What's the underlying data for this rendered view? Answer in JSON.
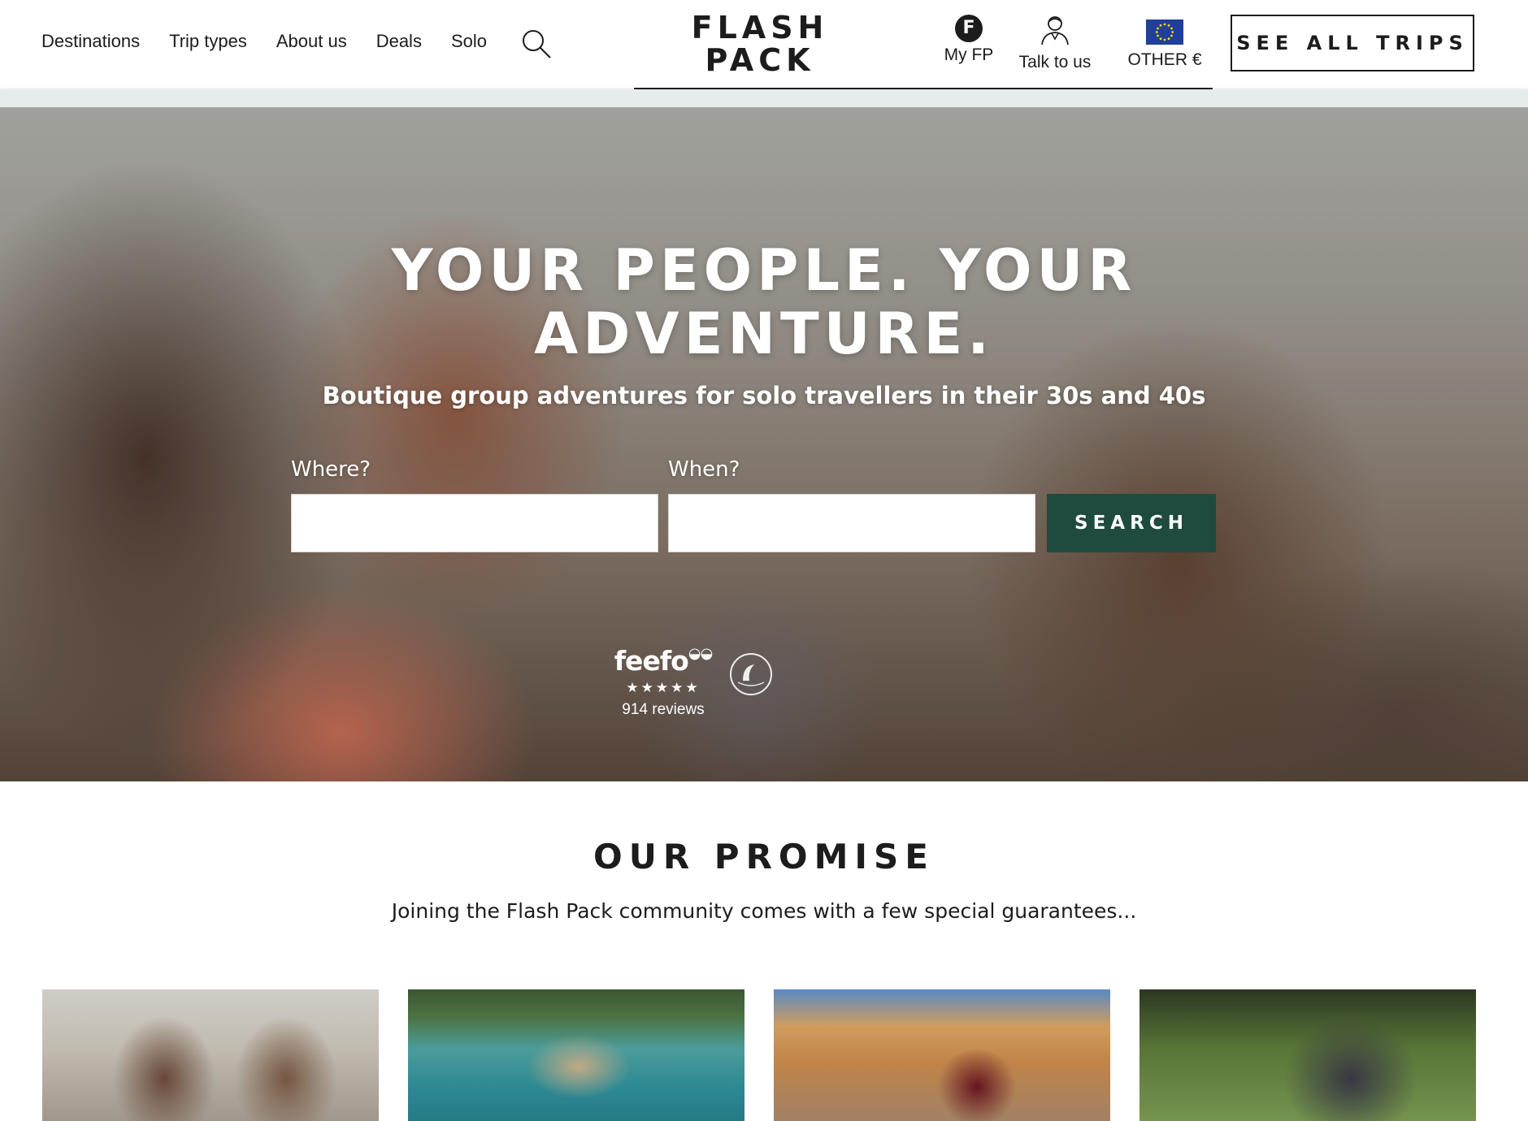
{
  "nav": {
    "items": [
      {
        "label": "Destinations"
      },
      {
        "label": "Trip types"
      },
      {
        "label": "About us"
      },
      {
        "label": "Deals"
      },
      {
        "label": "Solo"
      }
    ],
    "search_icon": "search-icon"
  },
  "logo": {
    "line1": "FLASH",
    "line2": "PACK"
  },
  "utility": {
    "my_fp": {
      "label": "My FP",
      "badge": "F"
    },
    "talk": {
      "label": "Talk to us",
      "icon": "person-headset-icon"
    },
    "currency": {
      "label": "OTHER  €",
      "icon": "eu-flag-icon"
    }
  },
  "cta": {
    "see_all_trips": "SEE ALL TRIPS"
  },
  "hero": {
    "title_line1": "YOUR PEOPLE. YOUR",
    "title_line2": "ADVENTURE.",
    "subtitle": "Boutique group adventures for solo travellers in their 30s and 40s",
    "where_label": "Where?",
    "where_value": "",
    "when_label": "When?",
    "when_value": "",
    "search_button": "SEARCH",
    "feefo_logo": "feefo",
    "feefo_stars": "★★★★★",
    "feefo_reviews": "914 reviews",
    "feefo_rating": 5
  },
  "promise": {
    "title": "OUR PROMISE",
    "subtitle": "Joining the Flash Pack community comes with a few special guarantees..."
  },
  "colors": {
    "accent_green": "#1e4b3e",
    "text_dark": "#1c1c1c",
    "strip": "#e6eceb"
  }
}
